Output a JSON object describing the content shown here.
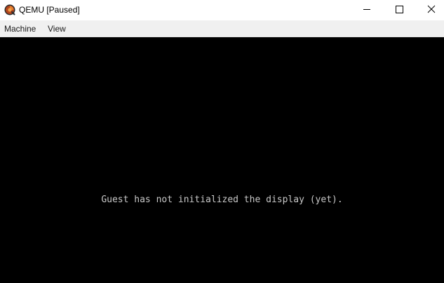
{
  "window": {
    "title": "QEMU [Paused]",
    "app_icon": "qemu-logo-icon",
    "controls": {
      "minimize_icon": "minimize-icon",
      "maximize_icon": "maximize-icon",
      "close_icon": "close-icon"
    }
  },
  "menubar": {
    "items": [
      {
        "label": "Machine"
      },
      {
        "label": "View"
      }
    ]
  },
  "display": {
    "message": "Guest has not initialized the display (yet).",
    "background_color": "#000000",
    "text_color": "#c8c8c8"
  }
}
